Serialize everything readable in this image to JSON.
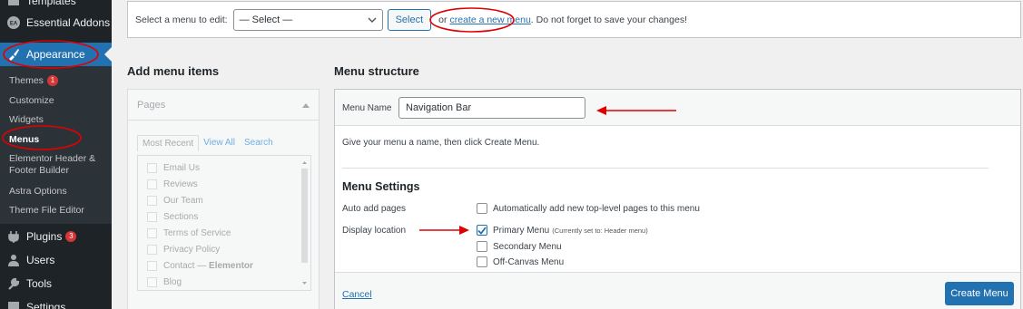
{
  "sidebar": {
    "items": [
      {
        "label": "Templates",
        "icon": "template-icon"
      },
      {
        "label": "Essential Addons",
        "icon": "ea-icon"
      },
      {
        "label": "Appearance",
        "icon": "paintbrush-icon"
      },
      {
        "label": "Plugins",
        "icon": "plugin-icon",
        "badge": "3"
      },
      {
        "label": "Users",
        "icon": "user-icon"
      },
      {
        "label": "Tools",
        "icon": "wrench-icon"
      },
      {
        "label": "Settings",
        "icon": "settings-icon"
      }
    ],
    "submenu": [
      {
        "label": "Themes",
        "badge": "1"
      },
      {
        "label": "Customize"
      },
      {
        "label": "Widgets"
      },
      {
        "label": "Menus"
      },
      {
        "label": "Elementor Header &"
      },
      {
        "label": "Footer Builder"
      },
      {
        "label": "Astra Options"
      },
      {
        "label": "Theme File Editor"
      }
    ],
    "ea_badge": "EA"
  },
  "topbar": {
    "prompt": "Select a menu to edit:",
    "select_value": "— Select —",
    "select_button": "Select",
    "or_text": "or",
    "create_link": "create a new menu",
    "trailing": ". Do not forget to save your changes!"
  },
  "add_items": {
    "heading": "Add menu items",
    "pages_title": "Pages",
    "tabs": [
      "Most Recent",
      "View All",
      "Search"
    ],
    "pages": [
      "Email Us",
      "Reviews",
      "Our Team",
      "Sections",
      "Terms of Service",
      "Privacy Policy",
      "Contact — Elementor",
      "Blog"
    ],
    "contact_base": "Contact —",
    "contact_suffix": "Elementor"
  },
  "structure": {
    "heading": "Menu structure",
    "name_label": "Menu Name",
    "name_value": "Navigation Bar",
    "hint": "Give your menu a name, then click Create Menu.",
    "settings_heading": "Menu Settings",
    "auto_add_label": "Auto add pages",
    "auto_add_option": "Automatically add new top-level pages to this menu",
    "display_label": "Display location",
    "locations": [
      {
        "label": "Primary Menu",
        "note": "(Currently set to: Header menu)",
        "checked": true
      },
      {
        "label": "Secondary Menu",
        "note": "",
        "checked": false
      },
      {
        "label": "Off-Canvas Menu",
        "note": "",
        "checked": false
      }
    ],
    "cancel": "Cancel",
    "create_button": "Create Menu"
  },
  "colors": {
    "sidebar_bg": "#1d2327",
    "active": "#2271b1",
    "badge": "#d63638",
    "annotation": "#e00000"
  }
}
